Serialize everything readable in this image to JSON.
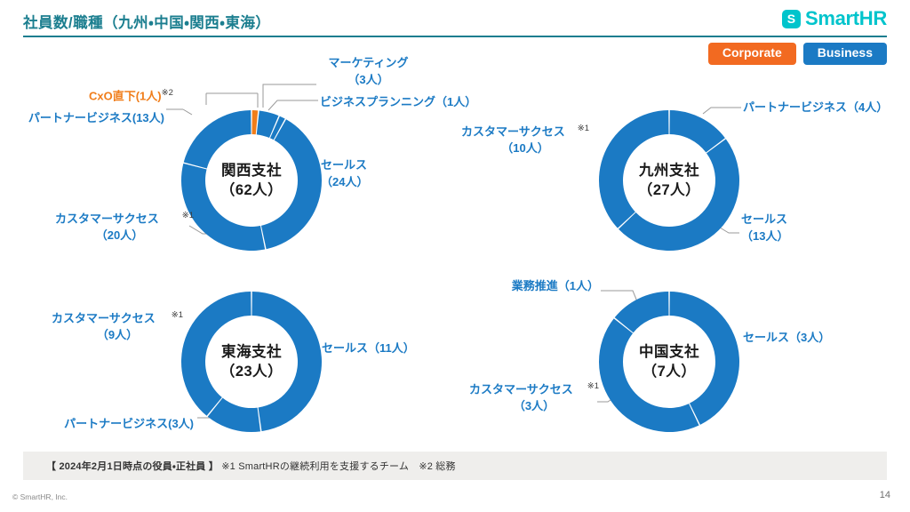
{
  "header": {
    "title": "社員数/職種（九州・中国・関西・東海）",
    "brand_name": "SmartHR",
    "brand_mark": "S",
    "tags": [
      {
        "label": "Corporate",
        "color": "#f26a21"
      },
      {
        "label": "Business",
        "color": "#1b7ac4"
      }
    ]
  },
  "colors": {
    "title_teal": "#1b7e8f",
    "blue": "#1b7ac4",
    "orange": "#f07d1a",
    "label_blue": "#1b7ac4",
    "brand_teal": "#00c4cc"
  },
  "footer": {
    "footnote_bold": "【 2024年2月1日時点の役員・正社員 】",
    "footnote_rest": "※1 SmartHRの継続利用を支援するチーム　※2 総務",
    "copyright": "© SmartHR, Inc.",
    "page_number": "14"
  },
  "chart_data": [
    {
      "id": "kansai",
      "type": "pie",
      "title": "関西支社",
      "total_label": "（62人）",
      "total": 62,
      "categories": [
        "CxO直下",
        "マーケティング",
        "ビジネスプランニング",
        "セールス",
        "カスタマーサクセス",
        "パートナービジネス"
      ],
      "values": [
        1,
        3,
        1,
        24,
        20,
        13
      ],
      "colors": [
        "#f07d1a",
        "#1b7ac4",
        "#1b7ac4",
        "#1b7ac4",
        "#1b7ac4",
        "#1b7ac4"
      ],
      "labels": [
        {
          "name": "cxo",
          "text": "CxO直下(1人)",
          "note": "※2",
          "color": "orange"
        },
        {
          "name": "marketing",
          "text_line1": "マーケティング",
          "text_line2": "（3人）",
          "note": ""
        },
        {
          "name": "bizplan",
          "text": "ビジネスプランニング（1人）",
          "note": ""
        },
        {
          "name": "sales",
          "text_line1": "セールス",
          "text_line2": "（24人）",
          "note": ""
        },
        {
          "name": "cs",
          "text_line1": "カスタマーサクセス",
          "text_line2": "（20人）",
          "note": "※1"
        },
        {
          "name": "partner",
          "text": "パートナービジネス(13人)",
          "note": ""
        }
      ]
    },
    {
      "id": "kyushu",
      "type": "pie",
      "title": "九州支社",
      "total_label": "（27人）",
      "total": 27,
      "categories": [
        "パートナービジネス",
        "セールス",
        "カスタマーサクセス"
      ],
      "values": [
        4,
        13,
        10
      ],
      "colors": [
        "#1b7ac4",
        "#1b7ac4",
        "#1b7ac4"
      ],
      "labels": [
        {
          "name": "partner",
          "text": "パートナービジネス（4人）",
          "note": ""
        },
        {
          "name": "sales",
          "text_line1": "セールス",
          "text_line2": "（13人）",
          "note": ""
        },
        {
          "name": "cs",
          "text_line1": "カスタマーサクセス",
          "text_line2": "（10人）",
          "note": "※1"
        }
      ]
    },
    {
      "id": "tokai",
      "type": "pie",
      "title": "東海支社",
      "total_label": "（23人）",
      "total": 23,
      "categories": [
        "セールス",
        "パートナービジネス",
        "カスタマーサクセス"
      ],
      "values": [
        11,
        3,
        9
      ],
      "colors": [
        "#1b7ac4",
        "#1b7ac4",
        "#1b7ac4"
      ],
      "labels": [
        {
          "name": "sales",
          "text": "セールス（11人）",
          "note": ""
        },
        {
          "name": "partner",
          "text": "パートナービジネス(3人)",
          "note": ""
        },
        {
          "name": "cs",
          "text_line1": "カスタマーサクセス",
          "text_line2": "（9人）",
          "note": "※1"
        }
      ]
    },
    {
      "id": "chugoku",
      "type": "pie",
      "title": "中国支社",
      "total_label": "（7人）",
      "total": 7,
      "categories": [
        "セールス",
        "カスタマーサクセス",
        "業務推進"
      ],
      "values": [
        3,
        3,
        1
      ],
      "colors": [
        "#1b7ac4",
        "#1b7ac4",
        "#1b7ac4"
      ],
      "labels": [
        {
          "name": "sales",
          "text": "セールス（3人）",
          "note": ""
        },
        {
          "name": "cs",
          "text_line1": "カスタマーサクセス",
          "text_line2": "（3人）",
          "note": "※1"
        },
        {
          "name": "gyomu",
          "text": "業務推進（1人）",
          "note": ""
        }
      ]
    }
  ]
}
